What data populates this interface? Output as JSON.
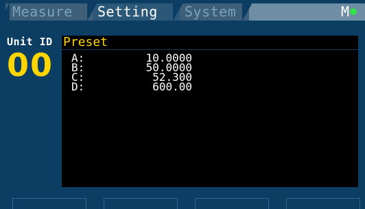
{
  "tabs": [
    {
      "label": "Measure"
    },
    {
      "label": "Setting",
      "active": true
    },
    {
      "label": "System"
    }
  ],
  "status": {
    "indicator_label": "M",
    "indicator_color": "#37e24a"
  },
  "unit": {
    "label": "Unit ID",
    "value": "00"
  },
  "preset": {
    "title": "Preset",
    "rows": [
      {
        "key": "A:",
        "value": "10.0000"
      },
      {
        "key": "B:",
        "value": "50.0000"
      },
      {
        "key": "C:",
        "value": "52.300"
      },
      {
        "key": "D:",
        "value": "600.00"
      }
    ]
  },
  "colors": {
    "background": "#0c3e64",
    "accent_yellow": "#ffd500",
    "panel": "#000000"
  }
}
